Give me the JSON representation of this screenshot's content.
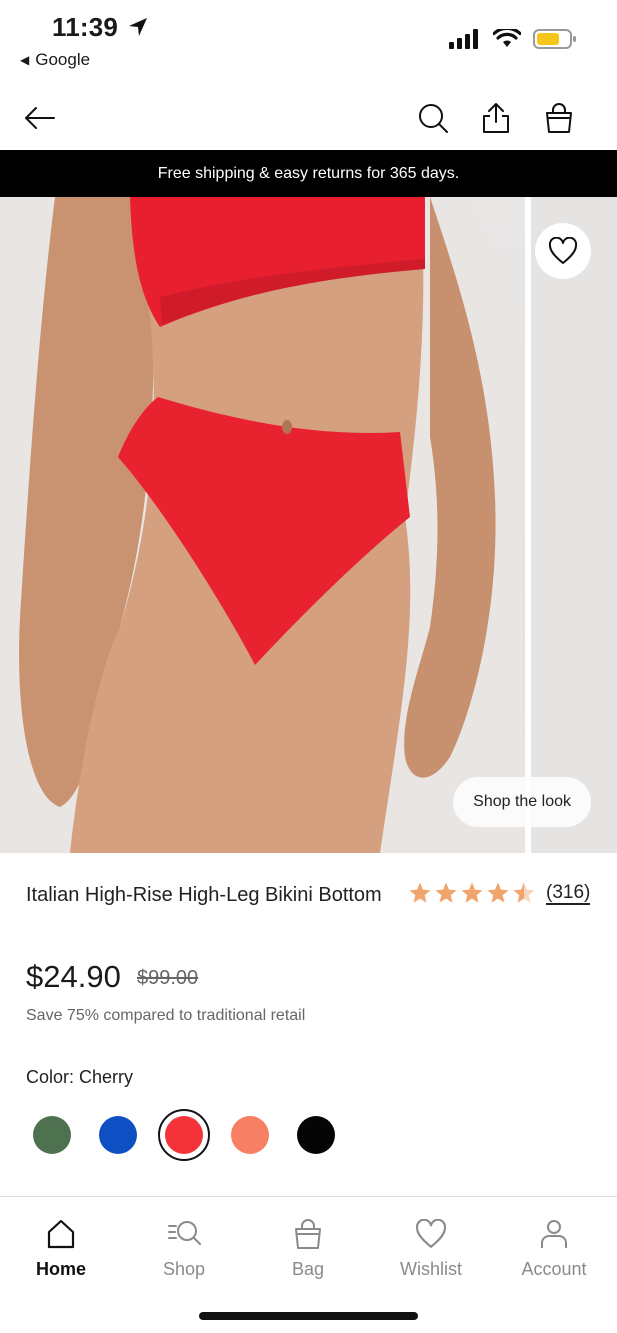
{
  "status_bar": {
    "time": "11:39",
    "back_app": "Google"
  },
  "toolbar": {
    "back_icon": "arrow-left-icon",
    "search_icon": "search-icon",
    "share_icon": "share-icon",
    "bag_icon": "shopping-bag-icon"
  },
  "banner": {
    "text": "Free shipping & easy returns for 365 days."
  },
  "gallery": {
    "wishlist_icon": "heart-icon",
    "shop_the_look": "Shop the look"
  },
  "product": {
    "title": "Italian High-Rise High-Leg Bikini Bottom",
    "rating": 4.5,
    "review_count": "(316)",
    "price": "$24.90",
    "original_price": "$99.00",
    "savings_text": "Save 75% compared to traditional retail",
    "color_label": "Color:",
    "color_value": "Cherry",
    "swatches": [
      {
        "name": "green",
        "color": "#4e7150"
      },
      {
        "name": "blue",
        "color": "#0f4fc4"
      },
      {
        "name": "cherry",
        "color": "#f4323a",
        "selected": true
      },
      {
        "name": "coral",
        "color": "#f77f63"
      },
      {
        "name": "black",
        "color": "#050505"
      }
    ],
    "star_color": "#f2a46d"
  },
  "tabbar": {
    "tabs": [
      {
        "label": "Home",
        "icon": "home-icon",
        "active": true
      },
      {
        "label": "Shop",
        "icon": "shop-search-icon"
      },
      {
        "label": "Bag",
        "icon": "bag-icon"
      },
      {
        "label": "Wishlist",
        "icon": "heart-icon"
      },
      {
        "label": "Account",
        "icon": "account-icon"
      }
    ]
  }
}
